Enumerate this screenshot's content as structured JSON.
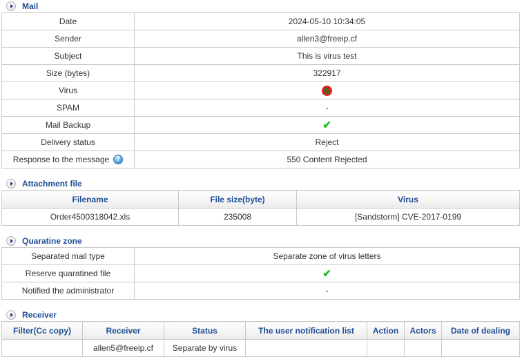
{
  "sections": {
    "mail": {
      "title": "Mail",
      "toggle_icon": "chevron-right-circle-icon",
      "rows": [
        {
          "label": "Date",
          "value": "2024-05-10 10:34:05",
          "kind": "text"
        },
        {
          "label": "Sender",
          "value": "allen3@freeip.cf",
          "kind": "text"
        },
        {
          "label": "Subject",
          "value": "This is virus test",
          "kind": "text"
        },
        {
          "label": "Size (bytes)",
          "value": "322917",
          "kind": "text"
        },
        {
          "label": "Virus",
          "value": "",
          "kind": "virus-icon"
        },
        {
          "label": "SPAM",
          "value": "-",
          "kind": "dash"
        },
        {
          "label": "Mail Backup",
          "value": "✔",
          "kind": "check"
        },
        {
          "label": "Delivery status",
          "value": "Reject",
          "kind": "red"
        },
        {
          "label": "Response to the message",
          "value": "550 Content Rejected",
          "kind": "bluelink",
          "help_icon": "question-mark-help-icon"
        }
      ]
    },
    "attachment": {
      "title": "Attachment file",
      "toggle_icon": "chevron-right-circle-icon",
      "headers": [
        "Filename",
        "File size(byte)",
        "Virus"
      ],
      "rows": [
        {
          "filename": "Order4500318042.xls",
          "filesize": "235008",
          "virus": "[Sandstorm] CVE-2017-0199"
        }
      ]
    },
    "quarantine": {
      "title": "Quaratine zone",
      "toggle_icon": "chevron-right-circle-icon",
      "rows": [
        {
          "label": "Separated mail type",
          "value": "Separate zone of virus letters",
          "kind": "text"
        },
        {
          "label": "Reserve quaratined file",
          "value": "✔",
          "kind": "check"
        },
        {
          "label": "Notified the administrator",
          "value": "-",
          "kind": "dash"
        }
      ]
    },
    "receiver": {
      "title": "Receiver",
      "toggle_icon": "chevron-right-circle-icon",
      "headers": [
        "Filter(Cc copy)",
        "Receiver",
        "Status",
        "The user notification list",
        "Action",
        "Actors",
        "Date of dealing"
      ],
      "rows": [
        {
          "filter": "",
          "receiver": "allen5@freeip.cf",
          "status": "Separate by virus",
          "notification_list": "",
          "action": "",
          "actors": "",
          "date_of_dealing": ""
        }
      ]
    }
  },
  "colors": {
    "section_title": "#1f4e96",
    "header_text": "#1f4e96",
    "alert_red": "#ff0000",
    "ok_green": "#22b422",
    "border": "#c9c9c9"
  }
}
